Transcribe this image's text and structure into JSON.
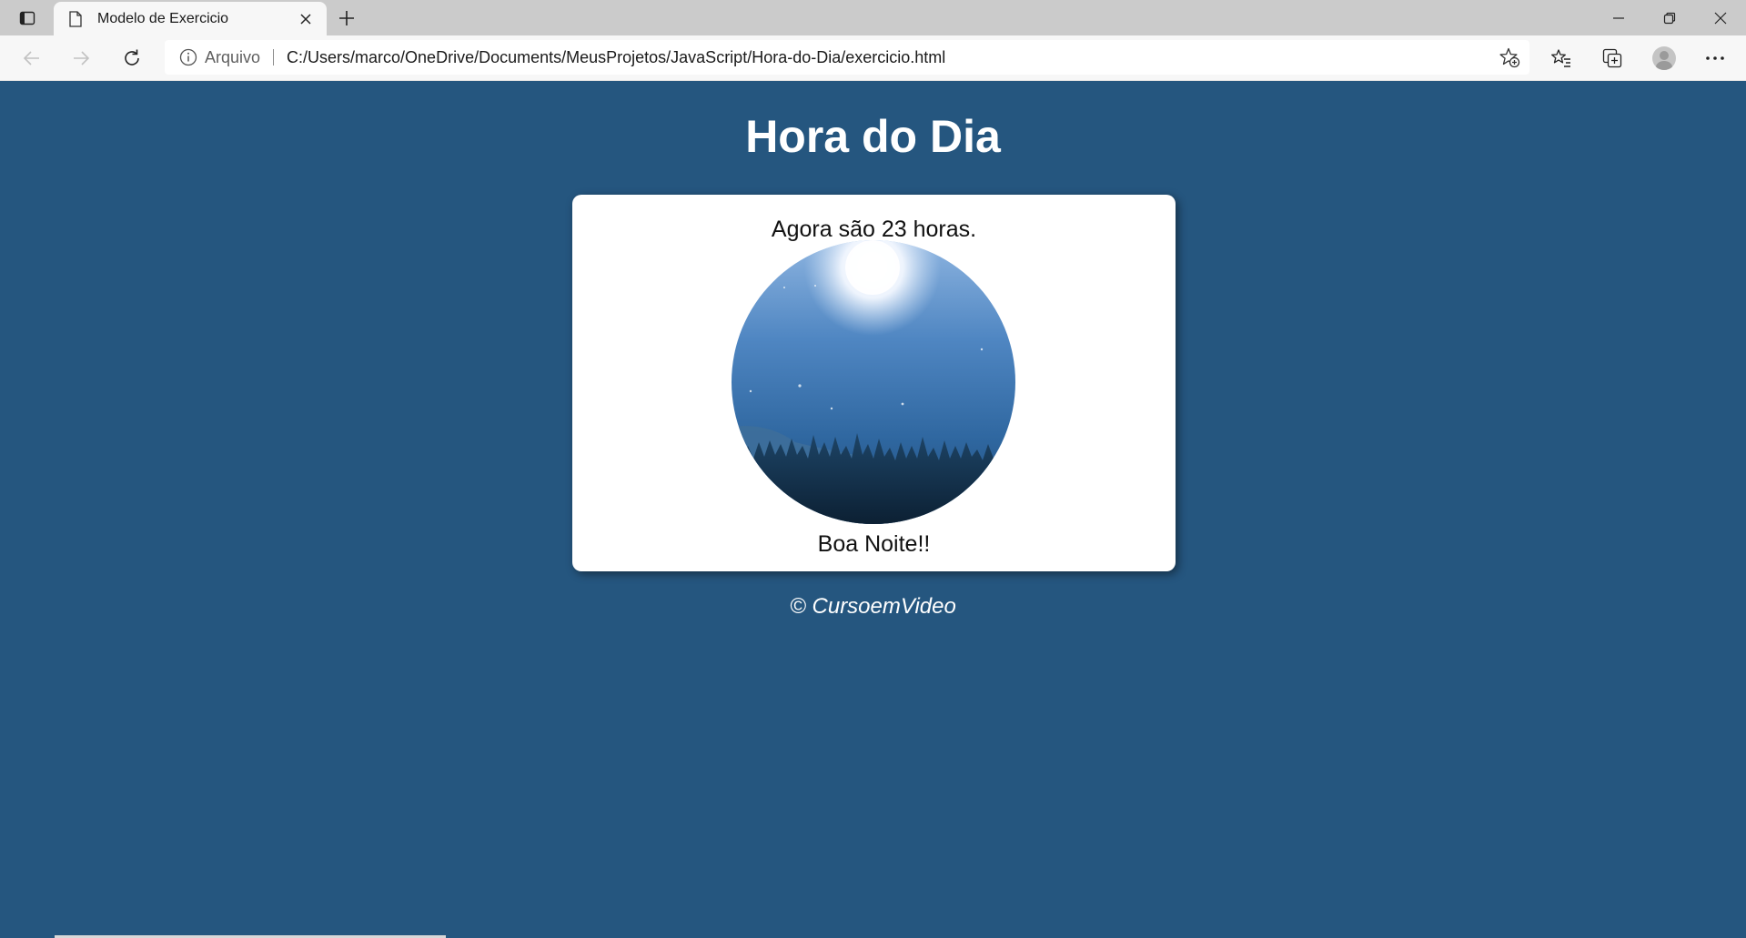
{
  "browser": {
    "tab": {
      "title": "Modelo de Exercicio"
    },
    "address_bar": {
      "scheme_label": "Arquivo",
      "url": "C:/Users/marco/OneDrive/Documents/MeusProjetos/JavaScript/Hora-do-Dia/exercicio.html"
    },
    "icons": {
      "tab_actions": "tab-actions-icon",
      "page": "page-icon",
      "close_tab": "close-icon",
      "new_tab": "plus-icon",
      "back": "back-arrow-icon",
      "forward": "forward-arrow-icon",
      "refresh": "refresh-icon",
      "info": "info-icon",
      "add_favorite": "star-plus-icon",
      "favorites": "favorites-icon",
      "collections": "collections-icon",
      "profile": "avatar",
      "more": "more-icon",
      "minimize": "minimize-icon",
      "restore": "restore-icon",
      "close_window": "close-icon"
    }
  },
  "page": {
    "header": "Hora do Dia",
    "message": "Agora são 23 horas.",
    "greeting": "Boa Noite!!",
    "footer": "© CursoemVideo"
  },
  "colors": {
    "page_background": "#25567f",
    "card_background": "#ffffff",
    "titlebar": "#cbcbcb",
    "toolbar": "#f7f7f7"
  }
}
